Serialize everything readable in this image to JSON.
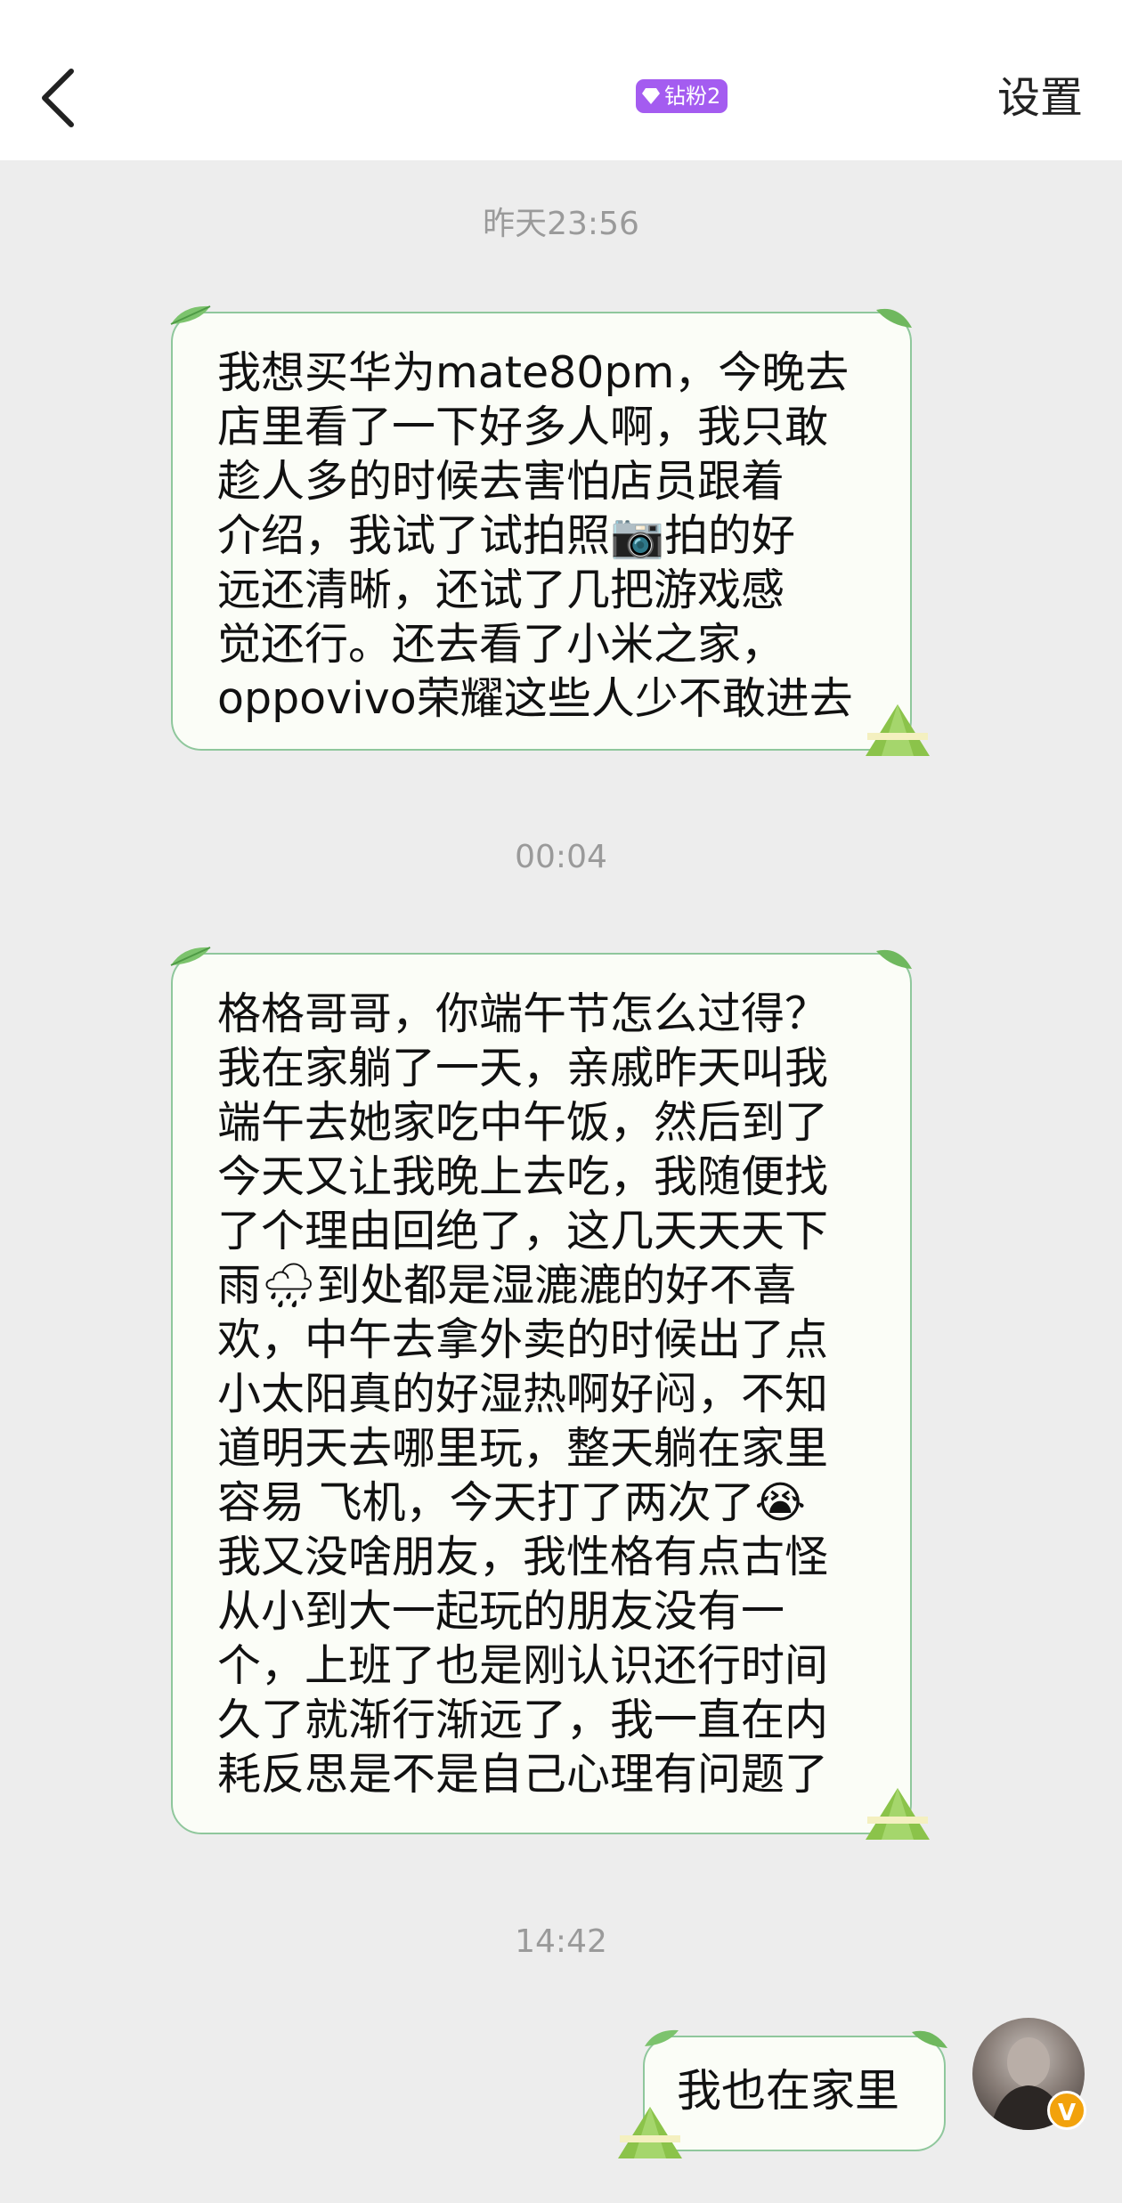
{
  "header": {
    "badge_label": "钻粉2",
    "settings_label": "设置"
  },
  "messages": [
    {
      "time": "昨天23:56",
      "text": "我想买华为mate80pm，今晚去\n店里看了一下好多人啊，我只敢\n趁人多的时候去害怕店员跟着\n介绍，我试了试拍照📷拍的好\n远还清晰，还试了几把游戏感\n觉还行。还去看了小米之家，\noppovivo荣耀这些人少不敢进去"
    },
    {
      "time": "00:04",
      "text": "格格哥哥，你端午节怎么过得？\n我在家躺了一天，亲戚昨天叫我\n端午去她家吃中午饭，然后到了\n今天又让我晚上去吃，我随便找\n了个理由回绝了，这几天天天下\n雨🌧到处都是湿漉漉的好不喜\n欢，中午去拿外卖的时候出了点\n小太阳真的好湿热啊好闷，不知\n道明天去哪里玩，整天躺在家里\n容易 飞机，今天打了两次了😭\n我又没啥朋友，我性格有点古怪\n从小到大一起玩的朋友没有一\n个，上班了也是刚认识还行时间\n久了就渐行渐远了，我一直在内\n耗反思是不是自己心理有问题了"
    },
    {
      "time": "14:42",
      "text": "我也在家里"
    }
  ],
  "colors": {
    "bubble_border": "#8fc79c",
    "bubble_fill": "#fbfdf7",
    "badge": "#a45cf0",
    "background": "#ededed"
  }
}
